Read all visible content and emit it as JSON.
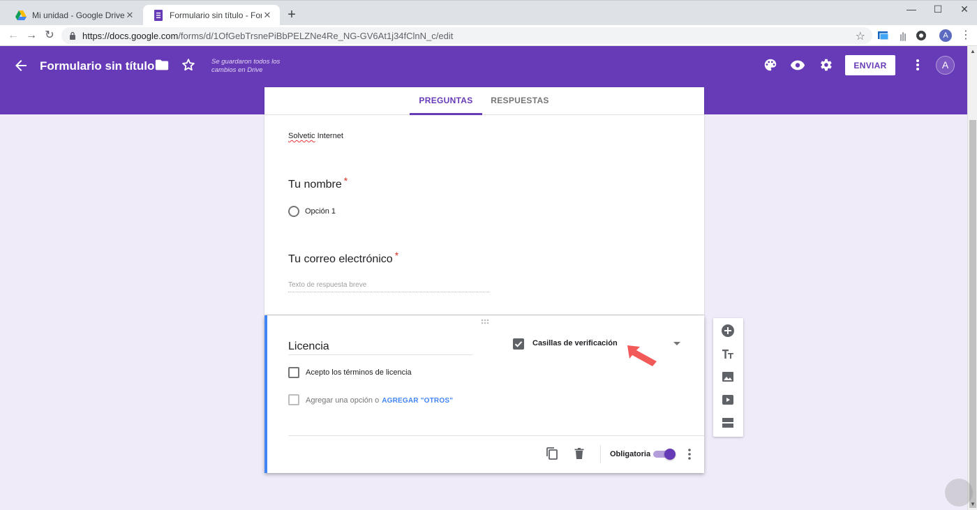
{
  "browser": {
    "tabs": [
      {
        "title": "Mi unidad - Google Drive",
        "close": "✕"
      },
      {
        "title": "Formulario sin título - Formularios",
        "close": "✕"
      }
    ],
    "new_tab": "+",
    "window_controls": {
      "minimize": "—",
      "maximize": "☐",
      "close": "✕"
    },
    "nav": {
      "back": "←",
      "forward": "→",
      "reload": "↻"
    },
    "url_host": "https://docs.google.com",
    "url_path": "/forms/d/1OfGebTrsnePiBbPELZNe4Re_NG-GV6At1j34fClnN_c/edit",
    "bookmark": "☆",
    "profile_initial": "A",
    "menu": "⋮"
  },
  "header": {
    "title": "Formulario sin título",
    "saved_status": "Se guardaron todos los cambios en Drive",
    "send_label": "ENVIAR",
    "avatar_initial": "A",
    "colors": {
      "brand": "#673ab7",
      "background": "#f0ebf8",
      "accent_blue": "#4285f4"
    }
  },
  "tabs": {
    "questions": "PREGUNTAS",
    "responses": "RESPUESTAS"
  },
  "form": {
    "description_word1": "Solvetic",
    "description_word2": " Internet",
    "questions": [
      {
        "title": "Tu nombre",
        "required_mark": "*",
        "option": "Opción 1"
      },
      {
        "title": "Tu correo electrónico",
        "required_mark": "*",
        "placeholder": "Texto de respuesta breve"
      }
    ]
  },
  "active_question": {
    "title": "Licencia",
    "type_label": "Casillas de verificación",
    "option": "Acepto los términos de licencia",
    "add_option": "Agregar una opción",
    "or": "o",
    "add_other": "AGREGAR \"OTROS\"",
    "required_label": "Obligatoria",
    "required_on": true
  },
  "side_tools": [
    "add-question-icon",
    "title-text-icon",
    "image-icon",
    "video-icon",
    "section-icon"
  ]
}
